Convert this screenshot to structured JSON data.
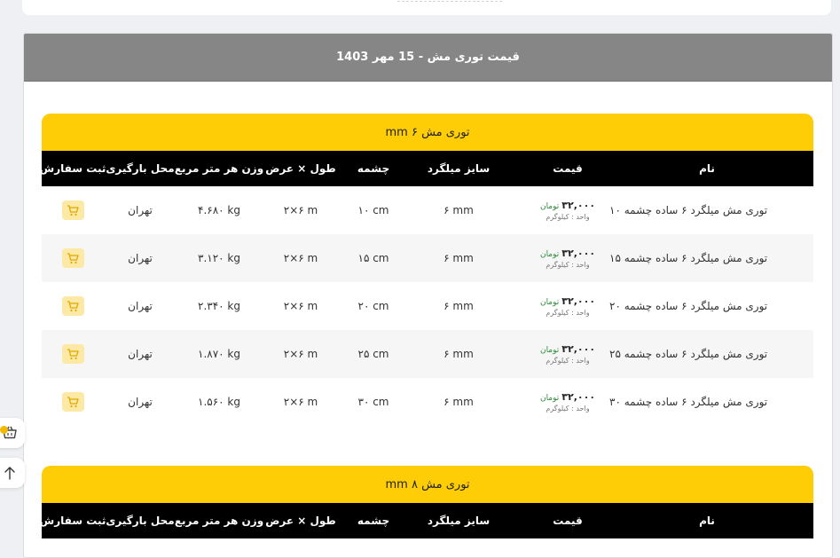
{
  "page_title": "قیمت توری مش - 15 مهر 1403",
  "columns": {
    "name": "نام",
    "price": "قیمت",
    "size": "سایز میلگرد",
    "mesh": "چشمه",
    "dim": "طول × عرض",
    "weight": "وزن هر متر مربع",
    "location": "محل بارگیری",
    "order": "ثبت سفارش"
  },
  "colors": {
    "accent": "#fecd06",
    "header_gray": "#868686",
    "currency_green": "#2e8b3a",
    "cart_bg": "#fde9a6"
  },
  "icons": {
    "cart": "cart-icon",
    "basket": "basket-icon",
    "arrow_up": "arrow-up-icon"
  },
  "tables": [
    {
      "title": "توری مش ۶ mm",
      "rows": [
        {
          "name": "توری مش میلگرد ۶ ساده چشمه ۱۰",
          "price": "۳۲,۰۰۰",
          "currency": "تومان",
          "unit": "واحد : کیلوگرم",
          "size": "۶ mm",
          "mesh": "۱۰ cm",
          "dim": "۲×۶ m",
          "weight": "۴.۶۸۰ kg",
          "location": "تهران"
        },
        {
          "name": "توری مش میلگرد ۶ ساده چشمه ۱۵",
          "price": "۳۲,۰۰۰",
          "currency": "تومان",
          "unit": "واحد : کیلوگرم",
          "size": "۶ mm",
          "mesh": "۱۵ cm",
          "dim": "۲×۶ m",
          "weight": "۳.۱۲۰ kg",
          "location": "تهران"
        },
        {
          "name": "توری مش میلگرد ۶ ساده چشمه ۲۰",
          "price": "۳۲,۰۰۰",
          "currency": "تومان",
          "unit": "واحد : کیلوگرم",
          "size": "۶ mm",
          "mesh": "۲۰ cm",
          "dim": "۲×۶ m",
          "weight": "۲.۳۴۰ kg",
          "location": "تهران"
        },
        {
          "name": "توری مش میلگرد ۶ ساده چشمه ۲۵",
          "price": "۳۲,۰۰۰",
          "currency": "تومان",
          "unit": "واحد : کیلوگرم",
          "size": "۶ mm",
          "mesh": "۲۵ cm",
          "dim": "۲×۶ m",
          "weight": "۱.۸۷۰ kg",
          "location": "تهران"
        },
        {
          "name": "توری مش میلگرد ۶ ساده چشمه ۳۰",
          "price": "۳۲,۰۰۰",
          "currency": "تومان",
          "unit": "واحد : کیلوگرم",
          "size": "۶ mm",
          "mesh": "۳۰ cm",
          "dim": "۲×۶ m",
          "weight": "۱.۵۶۰ kg",
          "location": "تهران"
        }
      ]
    },
    {
      "title": "توری مش ۸ mm",
      "rows": []
    }
  ]
}
